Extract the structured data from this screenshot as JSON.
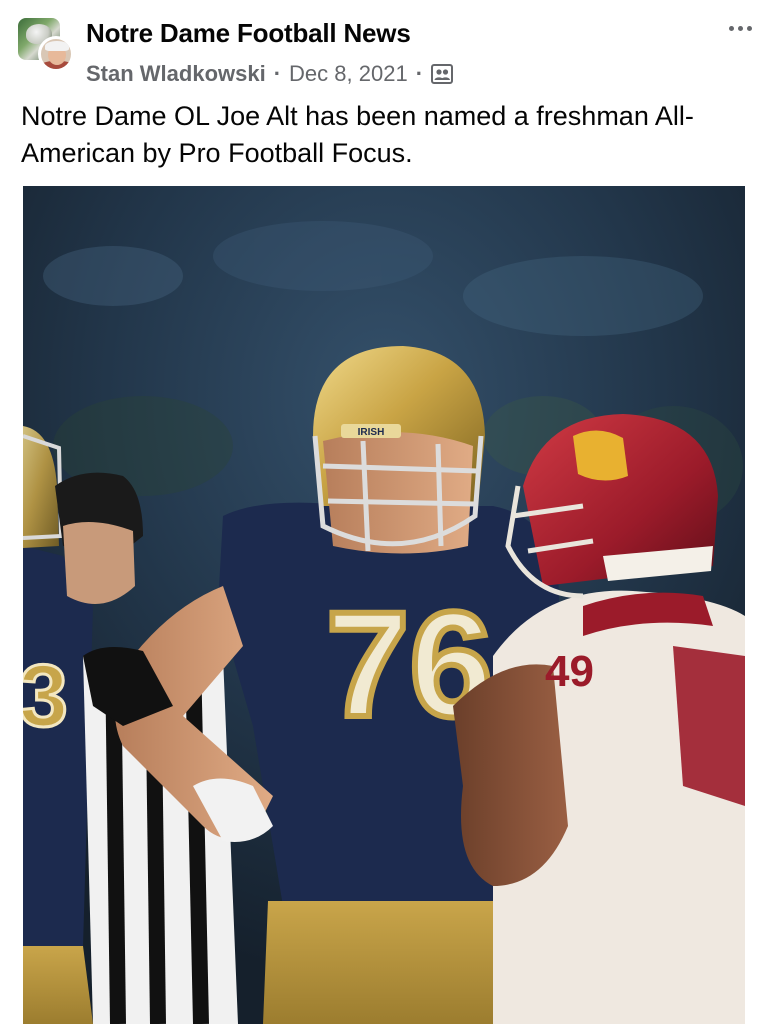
{
  "post": {
    "group_name": "Notre Dame Football News",
    "author": "Stan Wladkowski",
    "separator": "·",
    "date": "Dec 8, 2021",
    "audience_icon": "group-members-icon",
    "more_icon": "more-options-icon",
    "text": "Notre Dame OL Joe Alt has been named a freshman All-American by Pro Football Focus."
  },
  "photo": {
    "jersey_main": "76",
    "jersey_left": "3",
    "jersey_opponent": "49",
    "helmet_label": "IRISH"
  },
  "colors": {
    "text_primary": "#050505",
    "text_secondary": "#65676b",
    "navy": "#1c2a4e",
    "gold": "#c7a54a",
    "cardinal": "#9b1b2a"
  }
}
